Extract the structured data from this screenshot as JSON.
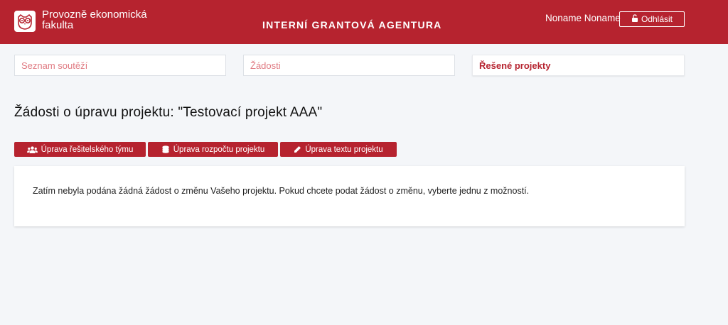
{
  "header": {
    "faculty_line1": "Provozně ekonomická",
    "faculty_line2": "fakulta",
    "agency_title": "INTERNÍ GRANTOVÁ AGENTURA",
    "user_name": "Noname Noname",
    "logout_label": "Odhlásit",
    "logo_icon": "owl-logo-icon",
    "logout_icon": "unlock-icon"
  },
  "nav": {
    "items": [
      {
        "label": "Seznam soutěží",
        "state": "muted"
      },
      {
        "label": "Žádosti",
        "state": "muted"
      },
      {
        "label": "Řešené projekty",
        "state": "active"
      }
    ]
  },
  "page": {
    "title": "Žádosti o úpravu projektu: \"Testovací projekt AAA\""
  },
  "actions": [
    {
      "label": "Úprava řešitelského týmu",
      "icon": "users-icon"
    },
    {
      "label": "Úprava rozpočtu projektu",
      "icon": "coins-icon"
    },
    {
      "label": "Úprava textu projektu",
      "icon": "pencil-icon"
    }
  ],
  "info": {
    "message": "Zatím nebyla podána žádná žádost o změnu Vašeho projektu. Pokud chcete podat žádost o změnu, vyberte jednu z možností."
  },
  "colors": {
    "brand": "#b6232f",
    "background": "#f4f6f9",
    "nav_muted_text": "#e07a82"
  }
}
